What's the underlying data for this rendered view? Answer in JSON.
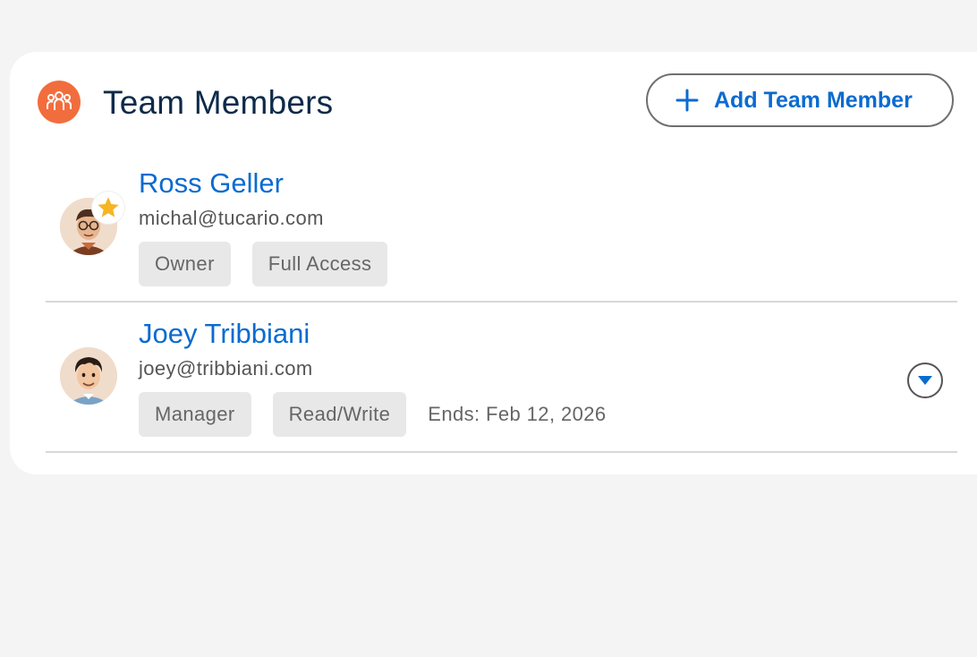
{
  "section": {
    "title": "Team Members",
    "icon": "team-icon",
    "accent_color": "#f26d3d"
  },
  "add_button": {
    "label": "Add Team Member",
    "icon": "plus-icon",
    "color": "#0a6bd0"
  },
  "members": [
    {
      "name": "Ross Geller",
      "email": "michal@tucario.com",
      "role": "Owner",
      "access": "Full Access",
      "badge": "star-icon"
    },
    {
      "name": "Joey Tribbiani",
      "email": "joey@tribbiani.com",
      "role": "Manager",
      "access": "Read/Write",
      "ends": "Ends: Feb 12, 2026",
      "action": "chevron-down-icon"
    }
  ]
}
